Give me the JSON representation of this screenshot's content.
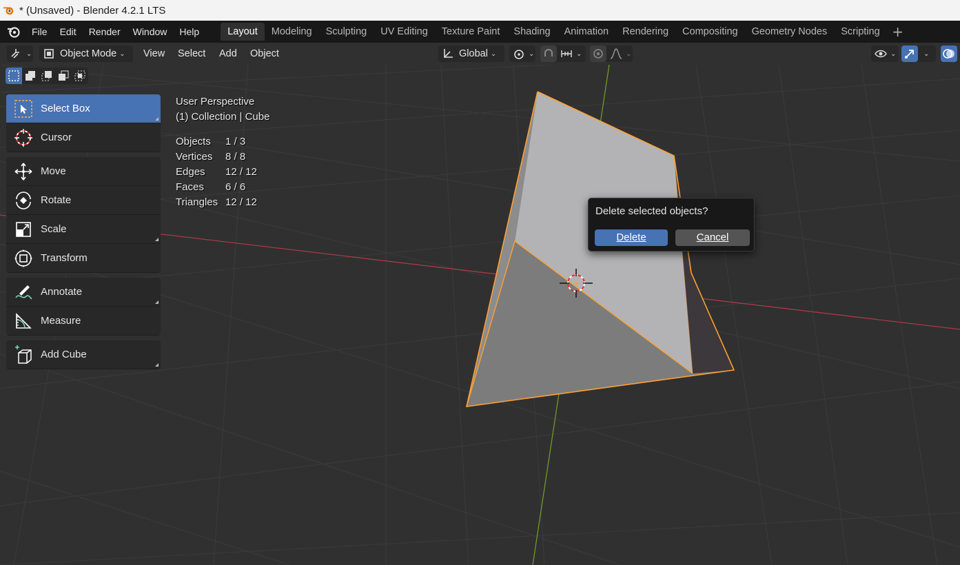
{
  "window": {
    "title": "* (Unsaved) - Blender 4.2.1 LTS"
  },
  "menu": [
    "File",
    "Edit",
    "Render",
    "Window",
    "Help"
  ],
  "workspaces": {
    "tabs": [
      "Layout",
      "Modeling",
      "Sculpting",
      "UV Editing",
      "Texture Paint",
      "Shading",
      "Animation",
      "Rendering",
      "Compositing",
      "Geometry Nodes",
      "Scripting"
    ],
    "active": "Layout"
  },
  "viewport_header": {
    "mode": "Object Mode",
    "menus": [
      "View",
      "Select",
      "Add",
      "Object"
    ],
    "orientation": "Global"
  },
  "toolbar": {
    "tools": [
      {
        "label": "Select Box",
        "icon": "select-box-icon",
        "active": true
      },
      {
        "label": "Cursor",
        "icon": "cursor-icon"
      },
      {
        "label": "Move",
        "icon": "move-icon"
      },
      {
        "label": "Rotate",
        "icon": "rotate-icon"
      },
      {
        "label": "Scale",
        "icon": "scale-icon"
      },
      {
        "label": "Transform",
        "icon": "transform-icon"
      },
      {
        "label": "Annotate",
        "icon": "annotate-icon"
      },
      {
        "label": "Measure",
        "icon": "measure-icon"
      },
      {
        "label": "Add Cube",
        "icon": "add-cube-icon"
      }
    ]
  },
  "overlay": {
    "view": "User Perspective",
    "collection": "(1) Collection | Cube",
    "stats": [
      {
        "key": "Objects",
        "value": "1 / 3"
      },
      {
        "key": "Vertices",
        "value": "8 / 8"
      },
      {
        "key": "Edges",
        "value": "12 / 12"
      },
      {
        "key": "Faces",
        "value": "6 / 6"
      },
      {
        "key": "Triangles",
        "value": "12 / 12"
      }
    ]
  },
  "dialog": {
    "message": "Delete selected objects?",
    "confirm": "Delete",
    "cancel": "Cancel"
  },
  "colors": {
    "accent": "#4772b3",
    "selection": "#ffa033",
    "x_axis": "#a83a46",
    "y_axis": "#6f9a28"
  }
}
